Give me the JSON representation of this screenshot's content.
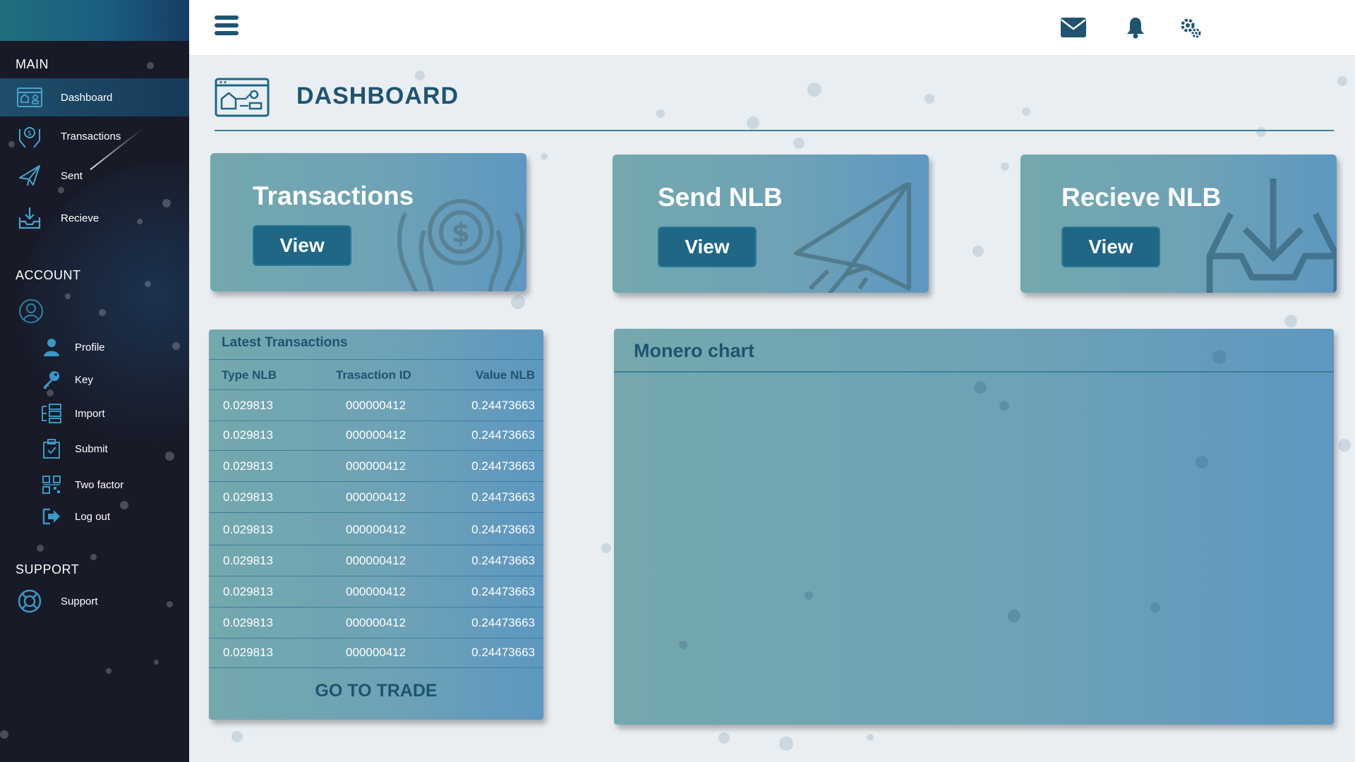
{
  "sidebar": {
    "sections": {
      "main": "MAIN",
      "account": "ACCOUNT",
      "support": "SUPPORT"
    },
    "main_items": [
      {
        "label": "Dashboard",
        "icon": "dashboard-icon",
        "active": true
      },
      {
        "label": "Transactions",
        "icon": "hands-coin-icon"
      },
      {
        "label": "Sent",
        "icon": "paper-plane-icon"
      },
      {
        "label": "Recieve",
        "icon": "inbox-download-icon"
      }
    ],
    "account_items": [
      {
        "label": "Profile",
        "icon": "person-icon"
      },
      {
        "label": "Key",
        "icon": "key-icon"
      },
      {
        "label": "Import",
        "icon": "import-icon"
      },
      {
        "label": "Submit",
        "icon": "submit-icon"
      },
      {
        "label": "Two factor",
        "icon": "qr-code-icon"
      },
      {
        "label": "Log out",
        "icon": "logout-icon"
      }
    ],
    "support_items": [
      {
        "label": "Support",
        "icon": "lifebuoy-icon"
      }
    ]
  },
  "topbar": {
    "icons": [
      "menu-icon",
      "mail-icon",
      "bell-icon",
      "gears-icon"
    ]
  },
  "page": {
    "title": "DASHBOARD",
    "icon": "dashboard-icon"
  },
  "cards": [
    {
      "title": "Transactions",
      "button": "View",
      "icon": "hands-coin-icon"
    },
    {
      "title": "Send NLB",
      "button": "View",
      "icon": "paper-plane-icon"
    },
    {
      "title": "Recieve NLB",
      "button": "View",
      "icon": "inbox-download-icon"
    }
  ],
  "latest_transactions": {
    "title": "Latest Transactions",
    "headers": [
      "Type  NLB",
      "Trasaction ID",
      "Value  NLB"
    ],
    "rows": [
      [
        "0.029813",
        "000000412",
        "0.24473663"
      ],
      [
        "0.029813",
        "000000412",
        "0.24473663"
      ],
      [
        "0.029813",
        "000000412",
        "0.24473663"
      ],
      [
        "0.029813",
        "000000412",
        "0.24473663"
      ],
      [
        "0.029813",
        "000000412",
        "0.24473663"
      ],
      [
        "0.029813",
        "000000412",
        "0.24473663"
      ],
      [
        "0.029813",
        "000000412",
        "0.24473663"
      ],
      [
        "0.029813",
        "000000412",
        "0.24473663"
      ],
      [
        "0.029813",
        "000000412",
        "0.24473663"
      ]
    ],
    "footer_link": "GO TO TRADE"
  },
  "monero_chart": {
    "title": "Monero chart"
  },
  "colors": {
    "primary": "#1f5470",
    "accent": "#1f6784",
    "sidebar": "#181a27",
    "card": "#6ea2b6"
  }
}
